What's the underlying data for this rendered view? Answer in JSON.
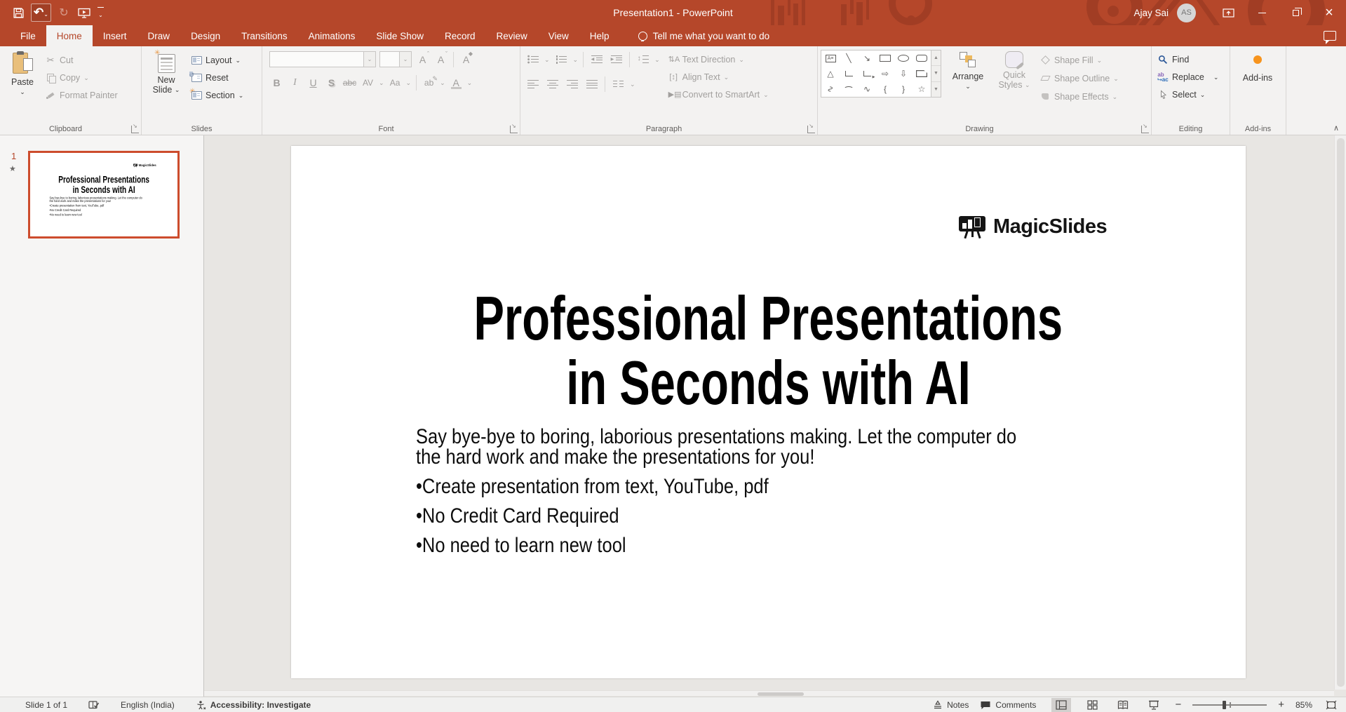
{
  "colors": {
    "titlebar": "#b5472a",
    "titlebar_dark": "#a13d24",
    "accent": "#b5472a",
    "ribbon_bg": "#f3f2f1",
    "text": "#3b3a39",
    "disabled": "#a19f9d",
    "panel": "#f6f5f4",
    "canvas": "#e8e6e3",
    "thumb_border": "#cd4c2d",
    "status": "#f0f0ef",
    "orange": "#f7941d",
    "tan": "#edb95e"
  },
  "titlebar": {
    "title": "Presentation1  -  PowerPoint",
    "user": "Ajay Sai",
    "initials": "AS"
  },
  "tabs": [
    {
      "label": "File",
      "active": false
    },
    {
      "label": "Home",
      "active": true
    },
    {
      "label": "Insert",
      "active": false
    },
    {
      "label": "Draw",
      "active": false
    },
    {
      "label": "Design",
      "active": false
    },
    {
      "label": "Transitions",
      "active": false
    },
    {
      "label": "Animations",
      "active": false
    },
    {
      "label": "Slide Show",
      "active": false
    },
    {
      "label": "Record",
      "active": false
    },
    {
      "label": "Review",
      "active": false
    },
    {
      "label": "View",
      "active": false
    },
    {
      "label": "Help",
      "active": false
    }
  ],
  "search": {
    "tellme": "Tell me what you want to do"
  },
  "ribbon": {
    "clipboard": {
      "label": "Clipboard",
      "paste": "Paste",
      "cut": "Cut",
      "copy": "Copy",
      "format_painter": "Format Painter"
    },
    "slides": {
      "label": "Slides",
      "new_slide_1": "New",
      "new_slide_2": "Slide",
      "layout": "Layout",
      "reset": "Reset",
      "section": "Section"
    },
    "font": {
      "label": "Font",
      "name_value": "",
      "size_value": "",
      "grow": "A",
      "shrink": "A",
      "clear": "A",
      "bold": "B",
      "italic": "I",
      "underline": "U",
      "shadow": "S",
      "strike": "abc",
      "spacing": "AV",
      "case": "Aa",
      "highlight": "ab",
      "color": "A"
    },
    "paragraph": {
      "label": "Paragraph",
      "text_direction": "Text Direction",
      "align_text": "Align Text",
      "smartart": "Convert to SmartArt"
    },
    "drawing": {
      "label": "Drawing",
      "arrange": "Arrange",
      "quick1": "Quick",
      "quick2": "Styles",
      "fill": "Shape Fill",
      "outline": "Shape Outline",
      "effects": "Shape Effects"
    },
    "editing": {
      "label": "Editing",
      "find": "Find",
      "replace": "Replace",
      "select": "Select"
    },
    "addins": {
      "label": "Add-ins",
      "button": "Add-ins"
    }
  },
  "thumbnail": {
    "number": "1"
  },
  "slide": {
    "logo": "MagicSlides",
    "title1": "Professional Presentations",
    "title2": "in Seconds with AI",
    "intro1": "Say bye-bye to boring, laborious presentations making. Let the computer do",
    "intro2": "the hard work and make the presentations for you!",
    "bullets": [
      "•Create presentation from text, YouTube, pdf",
      "•No Credit Card Required",
      "•No need to learn new tool"
    ]
  },
  "status": {
    "slide_indicator": "Slide 1 of 1",
    "language": "English (India)",
    "accessibility": "Accessibility: Investigate",
    "notes": "Notes",
    "comments": "Comments",
    "zoom": "85%"
  }
}
